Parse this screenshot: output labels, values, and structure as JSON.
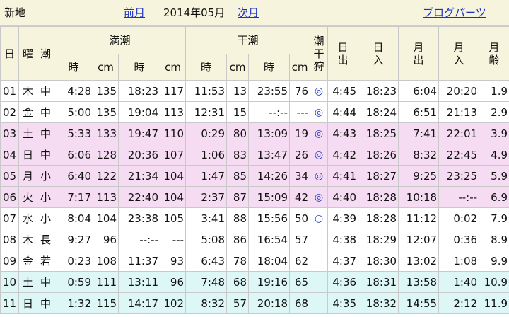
{
  "topbar": {
    "place": "新地",
    "prev_month": "前月",
    "current": "2014年05月",
    "next_month": "次月",
    "blog_parts": "ブログパーツ"
  },
  "header": {
    "day": "日",
    "weekday": "曜",
    "tide": "潮",
    "high_tide": "満潮",
    "low_tide": "干潮",
    "shellfish": [
      "潮",
      "干",
      "狩"
    ],
    "sunrise": [
      "日",
      "出"
    ],
    "sunset": [
      "日",
      "入"
    ],
    "moonrise": [
      "月",
      "出"
    ],
    "moonset": [
      "月",
      "入"
    ],
    "moon_age": [
      "月",
      "齢"
    ],
    "sub": [
      "時",
      "cm",
      "時",
      "cm",
      "時",
      "cm",
      "時",
      "cm"
    ]
  },
  "rows": [
    {
      "style": "w",
      "cells": [
        "01",
        "木",
        "中",
        "4:28",
        "135",
        "18:23",
        "117",
        "11:53",
        "13",
        "23:55",
        "76",
        "◎",
        "4:45",
        "18:23",
        "6:04",
        "20:20",
        "1.9"
      ]
    },
    {
      "style": "w",
      "cells": [
        "02",
        "金",
        "中",
        "5:00",
        "135",
        "19:04",
        "113",
        "12:31",
        "15",
        "--:--",
        "---",
        "◎",
        "4:44",
        "18:24",
        "6:51",
        "21:13",
        "2.9"
      ]
    },
    {
      "style": "p",
      "cells": [
        "03",
        "土",
        "中",
        "5:33",
        "133",
        "19:47",
        "110",
        "0:29",
        "80",
        "13:09",
        "19",
        "◎",
        "4:43",
        "18:25",
        "7:41",
        "22:01",
        "3.9"
      ]
    },
    {
      "style": "p",
      "cells": [
        "04",
        "日",
        "中",
        "6:06",
        "128",
        "20:36",
        "107",
        "1:06",
        "83",
        "13:47",
        "26",
        "◎",
        "4:42",
        "18:26",
        "8:32",
        "22:45",
        "4.9"
      ]
    },
    {
      "style": "p",
      "cells": [
        "05",
        "月",
        "小",
        "6:40",
        "122",
        "21:34",
        "104",
        "1:47",
        "85",
        "14:26",
        "34",
        "◎",
        "4:41",
        "18:27",
        "9:25",
        "23:25",
        "5.9"
      ]
    },
    {
      "style": "p",
      "cells": [
        "06",
        "火",
        "小",
        "7:17",
        "113",
        "22:40",
        "104",
        "2:37",
        "87",
        "15:09",
        "42",
        "◎",
        "4:40",
        "18:28",
        "10:18",
        "--:--",
        "6.9"
      ]
    },
    {
      "style": "w",
      "cells": [
        "07",
        "水",
        "小",
        "8:04",
        "104",
        "23:38",
        "105",
        "3:41",
        "88",
        "15:56",
        "50",
        "○",
        "4:39",
        "18:28",
        "11:12",
        "0:02",
        "7.9"
      ]
    },
    {
      "style": "w",
      "cells": [
        "08",
        "木",
        "長",
        "9:27",
        "96",
        "--:--",
        "---",
        "5:08",
        "86",
        "16:54",
        "57",
        "",
        "4:38",
        "18:29",
        "12:07",
        "0:36",
        "8.9"
      ]
    },
    {
      "style": "w",
      "cells": [
        "09",
        "金",
        "若",
        "0:23",
        "108",
        "11:37",
        "93",
        "6:43",
        "78",
        "18:04",
        "62",
        "",
        "4:37",
        "18:30",
        "13:02",
        "1:08",
        "9.9"
      ]
    },
    {
      "style": "t",
      "cells": [
        "10",
        "土",
        "中",
        "0:59",
        "111",
        "13:11",
        "96",
        "7:48",
        "68",
        "19:16",
        "65",
        "",
        "4:36",
        "18:31",
        "13:58",
        "1:40",
        "10.9"
      ]
    },
    {
      "style": "t",
      "cells": [
        "11",
        "日",
        "中",
        "1:32",
        "115",
        "14:17",
        "102",
        "8:32",
        "57",
        "20:18",
        "68",
        "",
        "4:35",
        "18:32",
        "14:55",
        "2:12",
        "11.9"
      ]
    }
  ],
  "colors": {
    "header_bg": "#f6f4dc",
    "weekend_pink": "#f6dcf2",
    "weekend_cyan": "#ddf6f6",
    "link_blue": "#1a31c6"
  }
}
